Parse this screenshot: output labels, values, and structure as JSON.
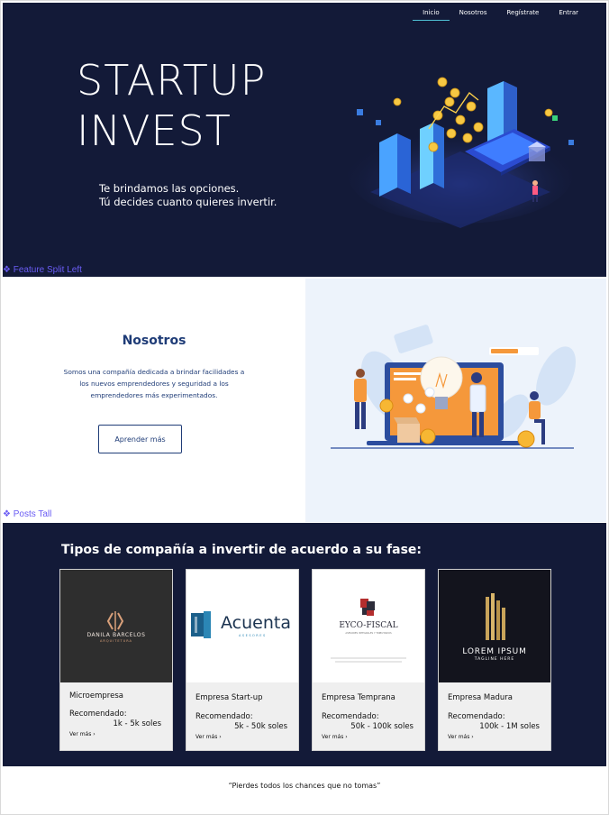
{
  "nav": {
    "items": [
      {
        "label": "Inicio",
        "active": true
      },
      {
        "label": "Nosotros",
        "active": false
      },
      {
        "label": "Regístrate",
        "active": false
      },
      {
        "label": "Entrar",
        "active": false
      }
    ]
  },
  "hero": {
    "title_line1": "STARTUP",
    "title_line2": "INVEST",
    "subtitle_line1": "Te brindamos las opciones.",
    "subtitle_line2": "Tú decides cuanto quieres invertir."
  },
  "sections": {
    "feature_label": "❖ Feature Split Left",
    "posts_label": "❖ Posts Tall"
  },
  "about": {
    "title": "Nosotros",
    "text_line1": "Somos una compañía dedicada a brindar facilidades a",
    "text_line2": "los nuevos emprendedores y seguridad a los",
    "text_line3": "emprendedores más experimentados.",
    "button_label": "Aprender más"
  },
  "posts": {
    "title": "Tipos de compañía a invertir de acuerdo a su fase:",
    "rec_label": "Recomendado:",
    "more_label": "Ver más ›",
    "cards": [
      {
        "name": "Microempresa",
        "range": "1k - 5k soles",
        "logo_main": "DANILA BARCELOS",
        "logo_sub": "ARQUITETURA"
      },
      {
        "name": "Empresa Start-up",
        "range": "5k - 50k soles",
        "logo_main": "Acuenta",
        "logo_sub": "ASESORES"
      },
      {
        "name": "Empresa Temprana",
        "range": "50k - 100k soles",
        "logo_main": "EYCO-FISCAL",
        "logo_sub": "ASESORES INTEGRALES Y TRIBUTARIOS"
      },
      {
        "name": "Empresa Madura",
        "range": "100k - 1M soles",
        "logo_main": "LOREM IPSUM",
        "logo_sub": "TAGLINE HERE"
      }
    ]
  },
  "quote": {
    "text": "“Pierdes todos los chances que no tomas”"
  },
  "colors": {
    "navy": "#131a38",
    "about_blue": "#1f3c77",
    "light_panel": "#edf3fb",
    "label_purple": "#6a5cf4",
    "accent_cyan": "#4fc3d6",
    "orange": "#f5983b"
  }
}
